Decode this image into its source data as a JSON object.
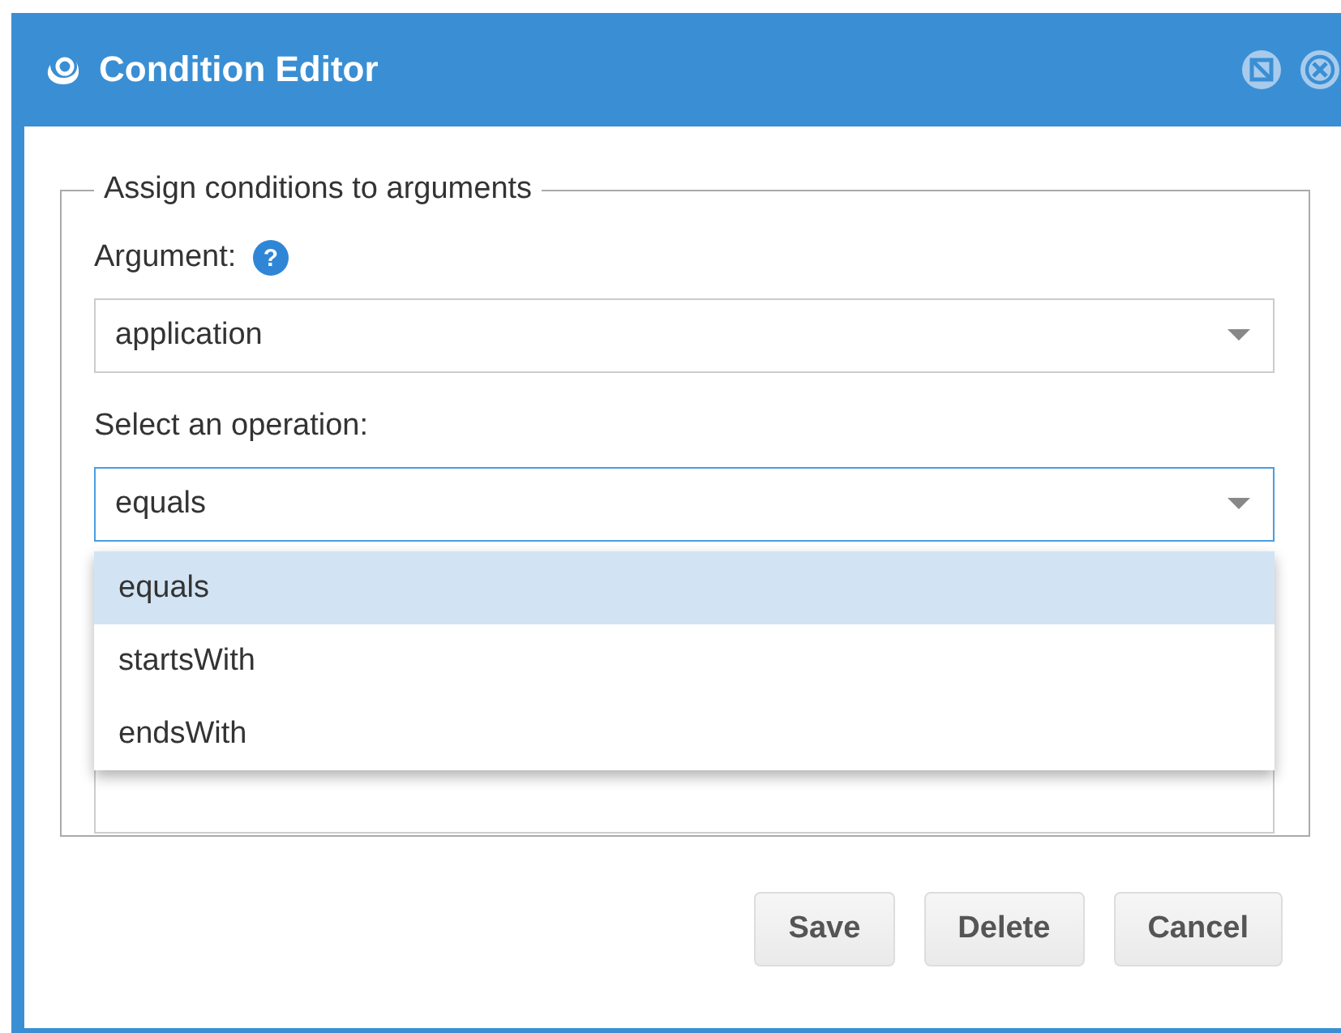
{
  "window": {
    "title": "Condition Editor"
  },
  "group": {
    "legend": "Assign conditions to arguments"
  },
  "argument": {
    "label": "Argument:",
    "help": "?",
    "value": "application"
  },
  "operation": {
    "label": "Select an operation:",
    "value": "equals",
    "expanded": true,
    "options": [
      {
        "label": "equals",
        "selected": true
      },
      {
        "label": "startsWith",
        "selected": false
      },
      {
        "label": "endsWith",
        "selected": false
      }
    ]
  },
  "buttons": [
    "Save",
    "Delete",
    "Cancel"
  ]
}
